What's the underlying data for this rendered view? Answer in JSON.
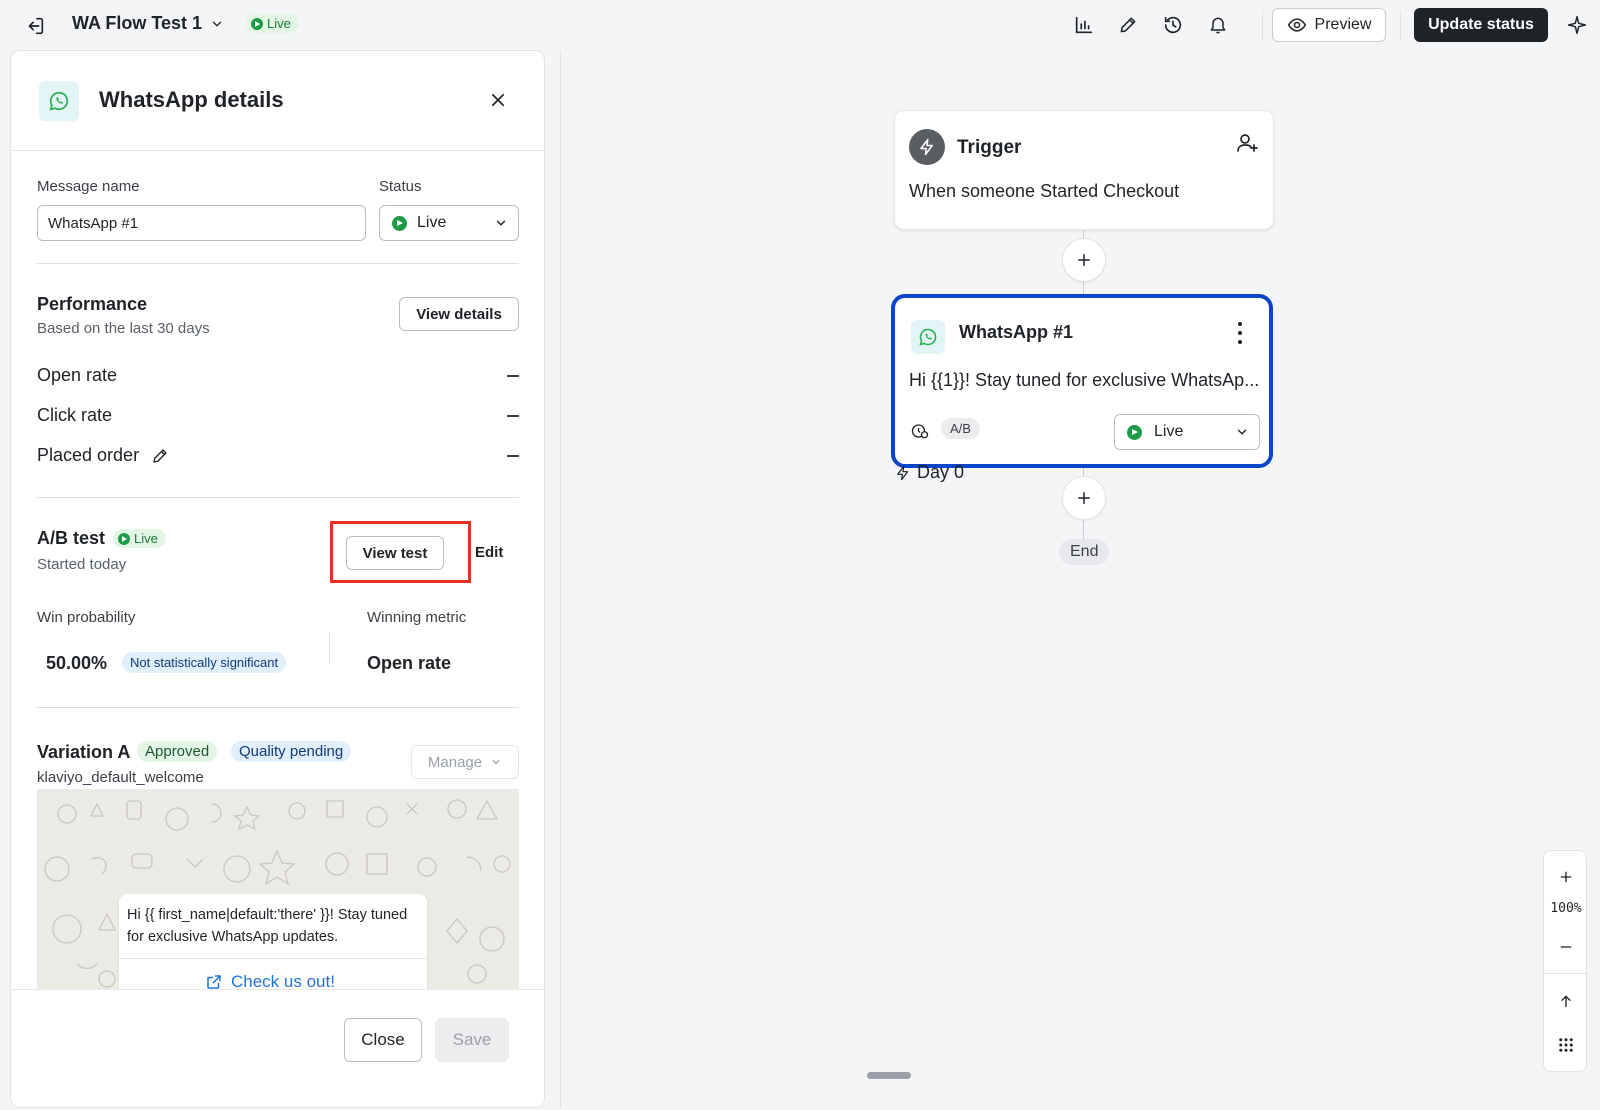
{
  "topbar": {
    "flow_title": "WA Flow Test 1",
    "status_label": "Live",
    "preview_label": "Preview",
    "update_status_label": "Update status"
  },
  "panel": {
    "title": "WhatsApp details",
    "message_name_label": "Message name",
    "message_name_value": "WhatsApp #1",
    "status_label": "Status",
    "status_value": "Live",
    "performance": {
      "title": "Performance",
      "subtitle": "Based on the last 30 days",
      "view_details_label": "View details",
      "metrics": [
        {
          "label": "Open rate",
          "value": "–"
        },
        {
          "label": "Click rate",
          "value": "–"
        },
        {
          "label": "Placed order",
          "value": "–"
        }
      ]
    },
    "ab_test": {
      "title": "A/B test",
      "status": "Live",
      "subtitle": "Started today",
      "view_test_label": "View test",
      "edit_label": "Edit",
      "win_probability_label": "Win probability",
      "win_probability_value": "50.00%",
      "significance_badge": "Not statistically significant",
      "winning_metric_label": "Winning metric",
      "winning_metric_value": "Open rate"
    },
    "variation": {
      "title": "Variation A",
      "approved_badge": "Approved",
      "quality_badge": "Quality pending",
      "manage_label": "Manage",
      "template_name": "klaviyo_default_welcome",
      "message_text": "Hi {{ first_name|default:'there' }}! Stay tuned for exclusive WhatsApp updates.",
      "cta_label": "Check us out!"
    },
    "footer": {
      "close_label": "Close",
      "save_label": "Save"
    }
  },
  "canvas": {
    "trigger": {
      "title": "Trigger",
      "description": "When someone Started Checkout"
    },
    "whatsapp_node": {
      "title": "WhatsApp #1",
      "preview": "Hi {{1}}! Stay tuned for exclusive WhatsAp...",
      "ab_label": "A/B",
      "status_value": "Live"
    },
    "delay_label": "Day 0",
    "end_label": "End",
    "zoom_level": "100%"
  },
  "colors": {
    "live_green": "#1e9a48",
    "selection_blue": "#0b45c8",
    "highlight_red": "#e8321e",
    "primary_dark": "#1f2328",
    "link_blue": "#1f73d9"
  }
}
